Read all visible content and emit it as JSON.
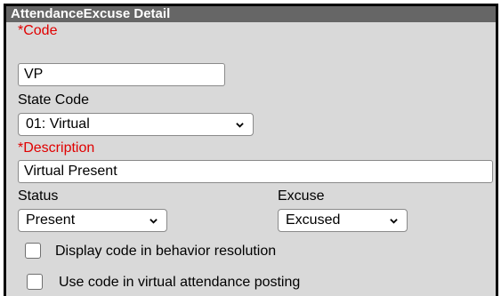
{
  "panel": {
    "title": "AttendanceExcuse Detail"
  },
  "code": {
    "label": "*Code",
    "value": "VP"
  },
  "state_code": {
    "label": "State Code",
    "selected": "01: Virtual"
  },
  "description": {
    "label": "*Description",
    "value": "Virtual Present"
  },
  "status": {
    "label": "Status",
    "selected": "Present"
  },
  "excuse": {
    "label": "Excuse",
    "selected": "Excused"
  },
  "checkboxes": [
    {
      "label": "Display code in behavior resolution",
      "checked": false
    },
    {
      "label": "Use code in virtual attendance posting",
      "checked": false
    }
  ],
  "colors": {
    "required": "#e00000",
    "titlebar_bg": "#666666",
    "panel_bg": "#d9d9d9"
  },
  "icons": {
    "dropdown": "chevron-down-icon"
  }
}
